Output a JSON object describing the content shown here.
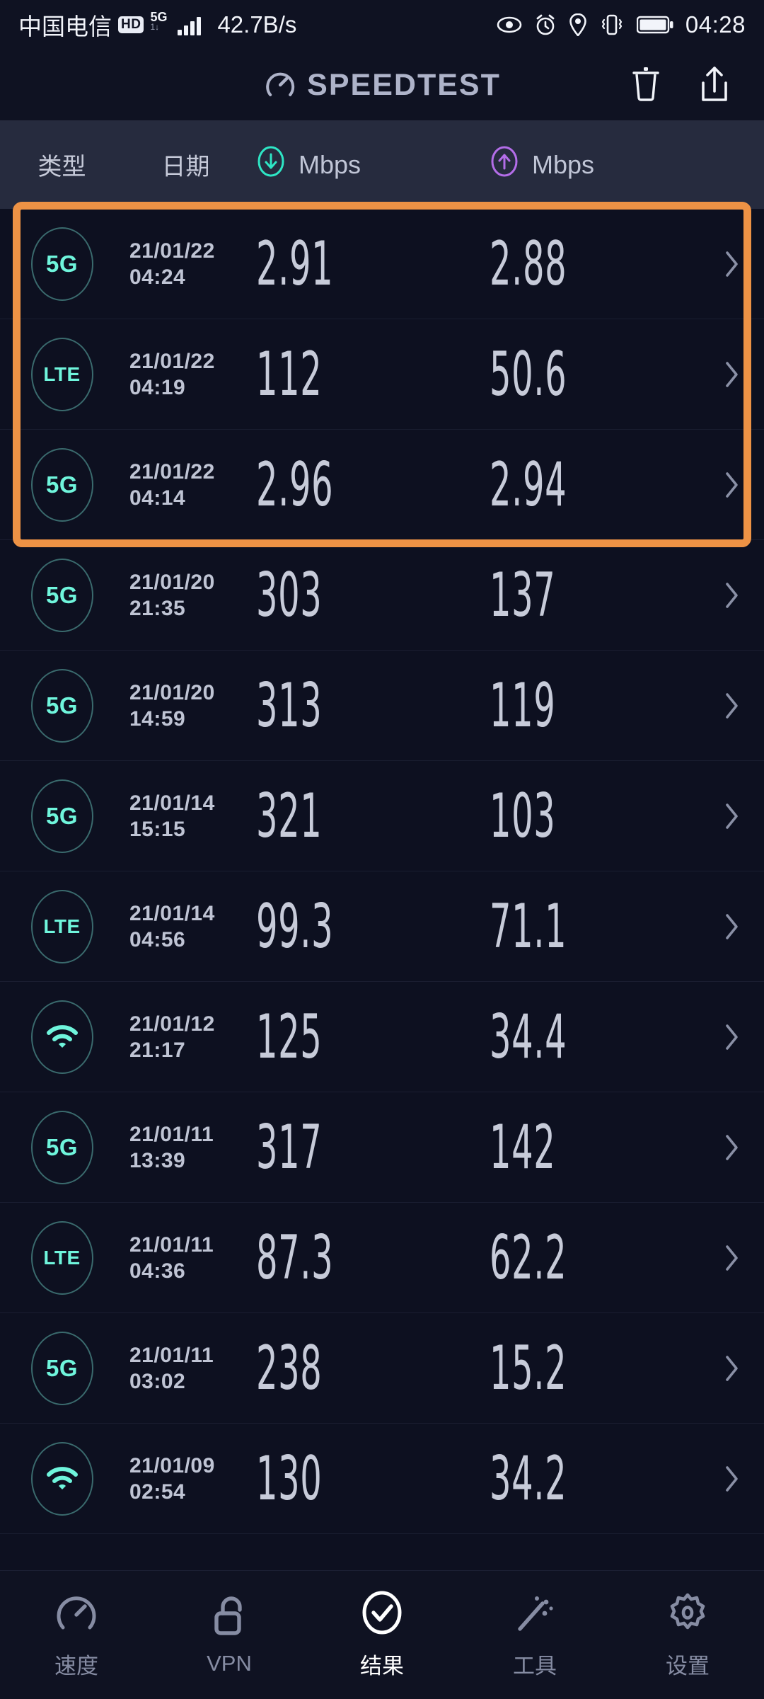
{
  "status_bar": {
    "carrier": "中国电信",
    "hd_badge": "HD",
    "net_type": "5G",
    "net_sub": "1↓",
    "data_speed": "42.7B/s",
    "clock": "04:28",
    "icons": [
      "eye-icon",
      "alarm-clock-icon",
      "location-pin-icon",
      "vibrate-icon",
      "battery-icon"
    ]
  },
  "app_bar": {
    "title": "SPEEDTEST",
    "logo_icon": "speedometer-icon",
    "delete_icon": "trash-icon",
    "share_icon": "share-icon"
  },
  "column_header": {
    "type": "类型",
    "date": "日期",
    "download_label": "Mbps",
    "upload_label": "Mbps",
    "download_icon": "download-arrow-icon",
    "upload_icon": "upload-arrow-icon",
    "download_color": "#2EE6C5",
    "upload_color": "#B36DE8"
  },
  "highlight": {
    "color": "#ED9245",
    "rows": [
      0,
      1,
      2
    ]
  },
  "results": [
    {
      "type": "5G",
      "icon": "5g-badge",
      "date": "21/01/22",
      "time": "04:24",
      "download": "2.91",
      "upload": "2.88"
    },
    {
      "type": "LTE",
      "icon": "lte-badge",
      "date": "21/01/22",
      "time": "04:19",
      "download": "112",
      "upload": "50.6"
    },
    {
      "type": "5G",
      "icon": "5g-badge",
      "date": "21/01/22",
      "time": "04:14",
      "download": "2.96",
      "upload": "2.94"
    },
    {
      "type": "5G",
      "icon": "5g-badge",
      "date": "21/01/20",
      "time": "21:35",
      "download": "303",
      "upload": "137"
    },
    {
      "type": "5G",
      "icon": "5g-badge",
      "date": "21/01/20",
      "time": "14:59",
      "download": "313",
      "upload": "119"
    },
    {
      "type": "5G",
      "icon": "5g-badge",
      "date": "21/01/14",
      "time": "15:15",
      "download": "321",
      "upload": "103"
    },
    {
      "type": "LTE",
      "icon": "lte-badge",
      "date": "21/01/14",
      "time": "04:56",
      "download": "99.3",
      "upload": "71.1"
    },
    {
      "type": "WIFI",
      "icon": "wifi-badge",
      "date": "21/01/12",
      "time": "21:17",
      "download": "125",
      "upload": "34.4"
    },
    {
      "type": "5G",
      "icon": "5g-badge",
      "date": "21/01/11",
      "time": "13:39",
      "download": "317",
      "upload": "142"
    },
    {
      "type": "LTE",
      "icon": "lte-badge",
      "date": "21/01/11",
      "time": "04:36",
      "download": "87.3",
      "upload": "62.2"
    },
    {
      "type": "5G",
      "icon": "5g-badge",
      "date": "21/01/11",
      "time": "03:02",
      "download": "238",
      "upload": "15.2"
    },
    {
      "type": "WIFI",
      "icon": "wifi-badge",
      "date": "21/01/09",
      "time": "02:54",
      "download": "130",
      "upload": "34.2"
    }
  ],
  "bottom_nav": {
    "active_index": 2,
    "items": [
      {
        "label": "速度",
        "icon": "speedometer-icon"
      },
      {
        "label": "VPN",
        "icon": "unlock-icon"
      },
      {
        "label": "结果",
        "icon": "check-circle-icon"
      },
      {
        "label": "工具",
        "icon": "magic-wand-icon"
      },
      {
        "label": "设置",
        "icon": "gear-icon"
      }
    ]
  }
}
